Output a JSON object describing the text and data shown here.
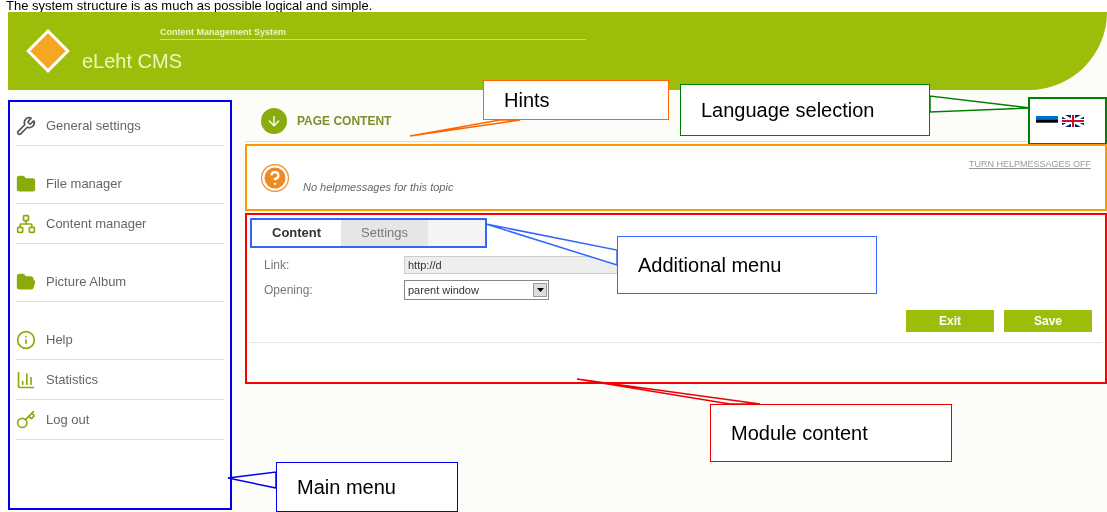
{
  "caption": "The system structure is as much as possible logical and simple.",
  "header": {
    "subtitle": "Content Management System",
    "brand": "eLeht CMS"
  },
  "main_menu": [
    [
      {
        "label": "General settings",
        "kind": "wrench"
      }
    ],
    [
      {
        "label": "File manager",
        "kind": "folder"
      },
      {
        "label": "Content manager",
        "kind": "tree"
      }
    ],
    [
      {
        "label": "Picture Album",
        "kind": "album"
      }
    ],
    [
      {
        "label": "Help",
        "kind": "help"
      },
      {
        "label": "Statistics",
        "kind": "chart"
      },
      {
        "label": "Log out",
        "kind": "key"
      }
    ]
  ],
  "page_title": "PAGE CONTENT",
  "hints": {
    "message": "No helpmessages for this topic",
    "toggle": "TURN HELPMESSAGES OFF"
  },
  "tabs": [
    {
      "label": "Content",
      "selected": true
    },
    {
      "label": "Settings",
      "selected": false
    }
  ],
  "form": [
    {
      "label": "Link:",
      "kind": "text",
      "value": "http://d"
    },
    {
      "label": "Opening:",
      "kind": "select",
      "value": "parent window"
    }
  ],
  "buttons": [
    "Exit",
    "Save"
  ],
  "callouts": [
    {
      "text": "Hints",
      "color": "#ff6600"
    },
    {
      "text": "Language selection",
      "color": "#008000"
    },
    {
      "text": "Additional menu",
      "color": "#3366ff"
    },
    {
      "text": "Module content",
      "color": "#ee0000"
    },
    {
      "text": "Main menu",
      "color": "#0000ee"
    }
  ]
}
